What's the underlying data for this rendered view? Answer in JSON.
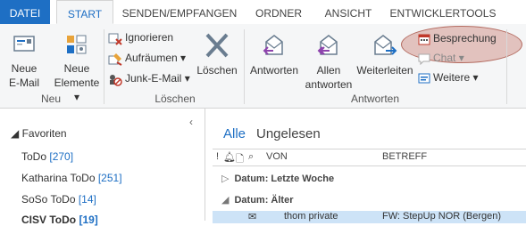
{
  "tabs": {
    "file": "DATEI",
    "start": "START",
    "send": "SENDEN/EMPFANGEN",
    "folder": "ORDNER",
    "view": "ANSICHT",
    "dev": "ENTWICKLERTOOLS"
  },
  "ribbon": {
    "neu": {
      "label": "Neu",
      "new_email_l1": "Neue",
      "new_email_l2": "E-Mail",
      "new_items_l1": "Neue",
      "new_items_l2": "Elemente"
    },
    "loeschen": {
      "label": "Löschen",
      "ignore": "Ignorieren",
      "cleanup": "Aufräumen",
      "junk": "Junk-E-Mail",
      "delete": "Löschen"
    },
    "antworten": {
      "label": "Antworten",
      "reply": "Antworten",
      "reply_all_l1": "Allen",
      "reply_all_l2": "antworten",
      "forward": "Weiterleiten",
      "meeting": "Besprechung",
      "chat": "Chat",
      "more": "Weitere"
    }
  },
  "favorites": {
    "header": "Favoriten",
    "items": [
      {
        "name": "ToDo",
        "count": "[270]"
      },
      {
        "name": "Katharina ToDo",
        "count": "[251]"
      },
      {
        "name": "SoSo ToDo",
        "count": "[14]"
      },
      {
        "name": "CISV ToDo",
        "count": "[19]"
      }
    ]
  },
  "list": {
    "filter_all": "Alle",
    "filter_unread": "Ungelesen",
    "col_from": "VON",
    "col_subject": "BETREFF",
    "group1": "Datum: Letzte Woche",
    "group2": "Datum: Älter",
    "row1_from": "thom private",
    "row1_subject": "FW: StepUp NOR (Bergen)"
  }
}
